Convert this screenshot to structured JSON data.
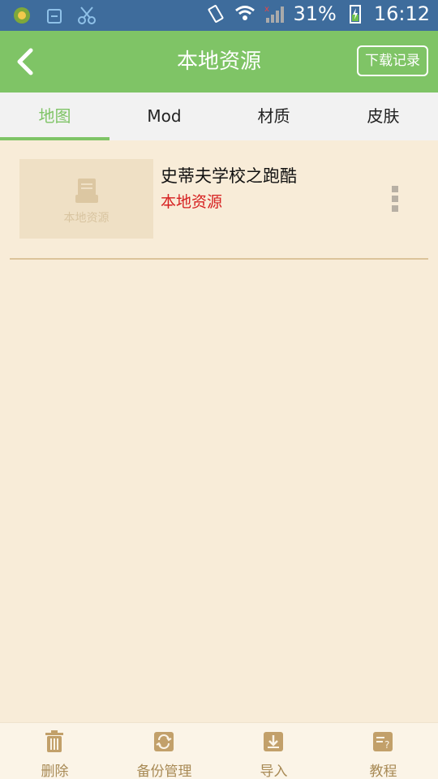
{
  "status_bar": {
    "battery": "31%",
    "time": "16:12"
  },
  "header": {
    "title": "本地资源",
    "download_label": "下载记录"
  },
  "tabs": [
    {
      "label": "地图"
    },
    {
      "label": "Mod"
    },
    {
      "label": "材质"
    },
    {
      "label": "皮肤"
    }
  ],
  "list": {
    "items": [
      {
        "title": "史蒂夫学校之跑酷",
        "subtitle": "本地资源",
        "thumb_label": "本地资源"
      }
    ]
  },
  "bottom_bar": [
    {
      "label": "删除",
      "icon": "trash-icon"
    },
    {
      "label": "备份管理",
      "icon": "backup-icon"
    },
    {
      "label": "导入",
      "icon": "import-icon"
    },
    {
      "label": "教程",
      "icon": "tutorial-icon"
    }
  ],
  "colors": {
    "header_green": "#7fc466",
    "background": "#f8ecd8",
    "status_bar": "#3e6c9c",
    "accent_red": "#d62020"
  }
}
